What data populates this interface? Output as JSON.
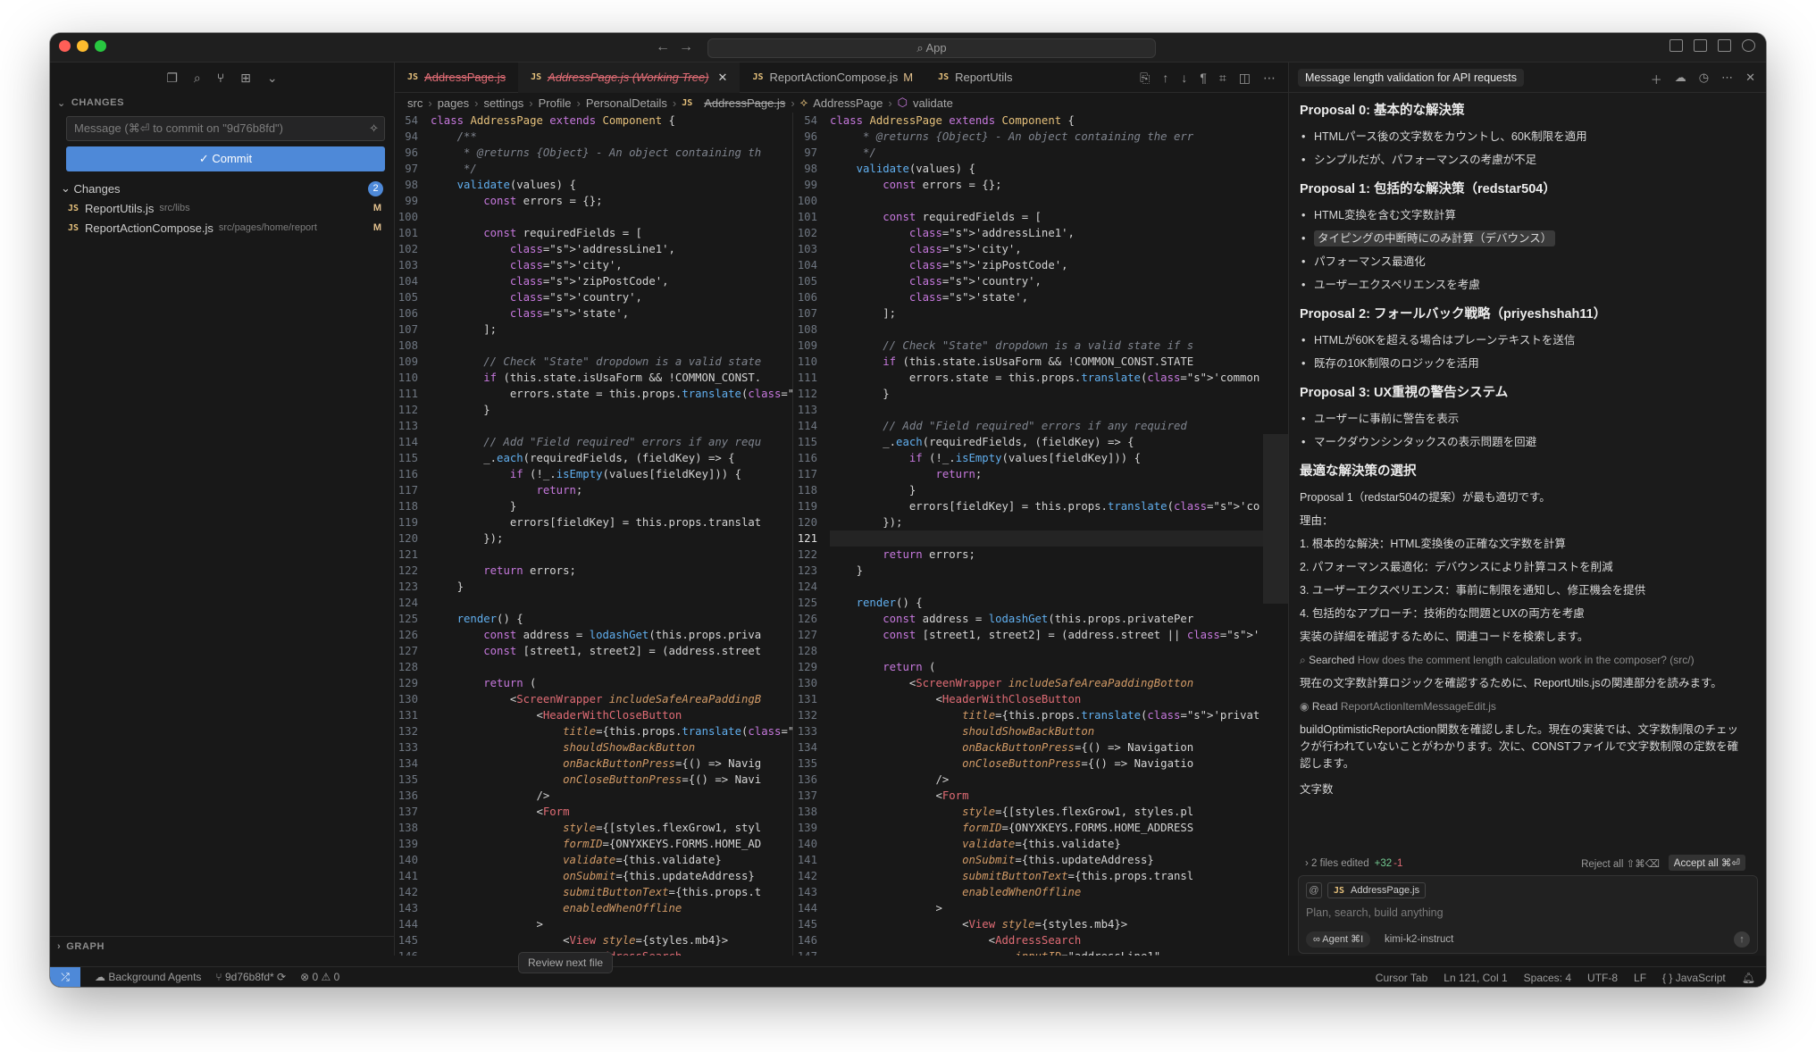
{
  "window": {
    "search_label": "App"
  },
  "sidebar": {
    "changes_header": "CHANGES",
    "commit_placeholder": "Message (⌘⏎ to commit on \"9d76b8fd\")",
    "commit_label": "✓ Commit",
    "changes_label": "Changes",
    "changes_count": "2",
    "files": [
      {
        "name": "ReportUtils.js",
        "path": "src/libs",
        "status": "M"
      },
      {
        "name": "ReportActionCompose.js",
        "path": "src/pages/home/report",
        "status": "M"
      }
    ],
    "graph_header": "GRAPH"
  },
  "tabs": [
    {
      "label": "AddressPage.js",
      "kind": "deleted"
    },
    {
      "label": "AddressPage.js (Working Tree)",
      "kind": "active"
    },
    {
      "label": "ReportActionCompose.js",
      "status": "M"
    },
    {
      "label": "ReportUtils"
    }
  ],
  "breadcrumb": [
    "src",
    "pages",
    "settings",
    "Profile",
    "PersonalDetails",
    "AddressPage.js",
    "AddressPage",
    "validate"
  ],
  "review_next": "Review next file",
  "code_left": [
    [
      "54",
      "class AddressPage extends Component {"
    ],
    [
      "94",
      "    /**"
    ],
    [
      "96",
      "     * @returns {Object} - An object containing th"
    ],
    [
      "97",
      "     */"
    ],
    [
      "98",
      "    validate(values) {"
    ],
    [
      "99",
      "        const errors = {};"
    ],
    [
      "100",
      ""
    ],
    [
      "101",
      "        const requiredFields = ["
    ],
    [
      "102",
      "            'addressLine1',"
    ],
    [
      "103",
      "            'city',"
    ],
    [
      "104",
      "            'zipPostCode',"
    ],
    [
      "105",
      "            'country',"
    ],
    [
      "106",
      "            'state',"
    ],
    [
      "107",
      "        ];"
    ],
    [
      "108",
      ""
    ],
    [
      "109",
      "        // Check \"State\" dropdown is a valid state"
    ],
    [
      "110",
      "        if (this.state.isUsaForm && !COMMON_CONST."
    ],
    [
      "111",
      "            errors.state = this.props.translate('c"
    ],
    [
      "112",
      "        }"
    ],
    [
      "113",
      ""
    ],
    [
      "114",
      "        // Add \"Field required\" errors if any requ"
    ],
    [
      "115",
      "        _.each(requiredFields, (fieldKey) => {"
    ],
    [
      "116",
      "            if (!_.isEmpty(values[fieldKey])) {"
    ],
    [
      "117",
      "                return;"
    ],
    [
      "118",
      "            }"
    ],
    [
      "119",
      "            errors[fieldKey] = this.props.translat"
    ],
    [
      "120",
      "        });"
    ],
    [
      "121",
      ""
    ],
    [
      "122",
      "        return errors;"
    ],
    [
      "123",
      "    }"
    ],
    [
      "124",
      ""
    ],
    [
      "125",
      "    render() {"
    ],
    [
      "126",
      "        const address = lodashGet(this.props.priva"
    ],
    [
      "127",
      "        const [street1, street2] = (address.street"
    ],
    [
      "128",
      ""
    ],
    [
      "129",
      "        return ("
    ],
    [
      "130",
      "            <ScreenWrapper includeSafeAreaPaddingB"
    ],
    [
      "131",
      "                <HeaderWithCloseButton"
    ],
    [
      "132",
      "                    title={this.props.translate('p"
    ],
    [
      "133",
      "                    shouldShowBackButton"
    ],
    [
      "134",
      "                    onBackButtonPress={() => Navig"
    ],
    [
      "135",
      "                    onCloseButtonPress={() => Navi"
    ],
    [
      "136",
      "                />"
    ],
    [
      "137",
      "                <Form"
    ],
    [
      "138",
      "                    style={[styles.flexGrow1, styl"
    ],
    [
      "139",
      "                    formID={ONYXKEYS.FORMS.HOME_AD"
    ],
    [
      "140",
      "                    validate={this.validate}"
    ],
    [
      "141",
      "                    onSubmit={this.updateAddress}"
    ],
    [
      "142",
      "                    submitButtonText={this.props.t"
    ],
    [
      "143",
      "                    enabledWhenOffline"
    ],
    [
      "144",
      "                >"
    ],
    [
      "145",
      "                    <View style={styles.mb4}>"
    ],
    [
      "146",
      "                        <AddressSearch"
    ]
  ],
  "code_right": [
    [
      "54",
      "class AddressPage extends Component {"
    ],
    [
      "96",
      "     * @returns {Object} - An object containing the err"
    ],
    [
      "97",
      "     */"
    ],
    [
      "98",
      "    validate(values) {"
    ],
    [
      "99",
      "        const errors = {};"
    ],
    [
      "100",
      ""
    ],
    [
      "101",
      "        const requiredFields = ["
    ],
    [
      "102",
      "            'addressLine1',"
    ],
    [
      "103",
      "            'city',"
    ],
    [
      "104",
      "            'zipPostCode',"
    ],
    [
      "105",
      "            'country',"
    ],
    [
      "106",
      "            'state',"
    ],
    [
      "107",
      "        ];"
    ],
    [
      "108",
      ""
    ],
    [
      "109",
      "        // Check \"State\" dropdown is a valid state if s"
    ],
    [
      "110",
      "        if (this.state.isUsaForm && !COMMON_CONST.STATE"
    ],
    [
      "111",
      "            errors.state = this.props.translate('common"
    ],
    [
      "112",
      "        }"
    ],
    [
      "113",
      ""
    ],
    [
      "114",
      "        // Add \"Field required\" errors if any required"
    ],
    [
      "115",
      "        _.each(requiredFields, (fieldKey) => {"
    ],
    [
      "116",
      "            if (!_.isEmpty(values[fieldKey])) {"
    ],
    [
      "117",
      "                return;"
    ],
    [
      "118",
      "            }"
    ],
    [
      "119",
      "            errors[fieldKey] = this.props.translate('co"
    ],
    [
      "120",
      "        });"
    ],
    [
      "121",
      ""
    ],
    [
      "122",
      "        return errors;"
    ],
    [
      "123",
      "    }"
    ],
    [
      "124",
      ""
    ],
    [
      "125",
      "    render() {"
    ],
    [
      "126",
      "        const address = lodashGet(this.props.privatePer"
    ],
    [
      "127",
      "        const [street1, street2] = (address.street || '"
    ],
    [
      "128",
      ""
    ],
    [
      "129",
      "        return ("
    ],
    [
      "130",
      "            <ScreenWrapper includeSafeAreaPaddingBotton"
    ],
    [
      "131",
      "                <HeaderWithCloseButton"
    ],
    [
      "132",
      "                    title={this.props.translate('privat"
    ],
    [
      "133",
      "                    shouldShowBackButton"
    ],
    [
      "134",
      "                    onBackButtonPress={() => Navigation"
    ],
    [
      "135",
      "                    onCloseButtonPress={() => Navigatio"
    ],
    [
      "136",
      "                />"
    ],
    [
      "137",
      "                <Form"
    ],
    [
      "138",
      "                    style={[styles.flexGrow1, styles.pl"
    ],
    [
      "139",
      "                    formID={ONYXKEYS.FORMS.HOME_ADDRESS"
    ],
    [
      "140",
      "                    validate={this.validate}"
    ],
    [
      "141",
      "                    onSubmit={this.updateAddress}"
    ],
    [
      "142",
      "                    submitButtonText={this.props.transl"
    ],
    [
      "143",
      "                    enabledWhenOffline"
    ],
    [
      "144",
      "                >"
    ],
    [
      "145",
      "                    <View style={styles.mb4}>"
    ],
    [
      "146",
      "                        <AddressSearch"
    ],
    [
      "147",
      "                            inputID=\"addressLine1\""
    ]
  ],
  "current_line": "121",
  "chat": {
    "title": "Message length validation for API requests",
    "p0_title": "Proposal 0: 基本的な解決策",
    "p0_items": [
      "HTMLパース後の文字数をカウントし、60K制限を適用",
      "シンプルだが、パフォーマンスの考慮が不足"
    ],
    "p1_title": "Proposal 1: 包括的な解決策（redstar504）",
    "p1_items": [
      "HTML変換を含む文字数計算",
      "タイピングの中断時にのみ計算（デバウンス）",
      "パフォーマンス最適化",
      "ユーザーエクスペリエンスを考慮"
    ],
    "p2_title": "Proposal 2: フォールバック戦略（priyeshshah11）",
    "p2_items": [
      "HTMLが60Kを超える場合はプレーンテキストを送信",
      "既存の10K制限のロジックを活用"
    ],
    "p3_title": "Proposal 3: UX重視の警告システム",
    "p3_items": [
      "ユーザーに事前に警告を表示",
      "マークダウンシンタックスの表示問題を回避"
    ],
    "best_title": "最適な解決策の選択",
    "best_intro": "Proposal 1（redstar504の提案）が最も適切です。",
    "reason_label": "理由：",
    "reasons": [
      "1. 根本的な解決：HTML変換後の正確な文字数を計算",
      "2. パフォーマンス最適化：デバウンスにより計算コストを削減",
      "3. ユーザーエクスペリエンス：事前に制限を通知し、修正機会を提供",
      "4. 包括的なアプローチ：技術的な問題とUXの両方を考慮"
    ],
    "search_intro": "実装の詳細を確認するために、関連コードを検索します。",
    "searched_label": "Searched",
    "searched_query": "How does the comment length calculation work in the composer? (src/)",
    "read_intro": "現在の文字数計算ロジックを確認するために、ReportUtils.jsの関連部分を読みます。",
    "read_label": "Read",
    "read_file": "ReportActionItemMessageEdit.js",
    "build_para": "buildOptimisticReportAction関数を確認しました。現在の実装では、文字数制限のチェックが行われていないことがわかります。次に、CONSTファイルで文字数制限の定数を確認します。",
    "char_count": "文字数",
    "files_edited": "2 files edited",
    "added": "+32",
    "removed": "-1",
    "reject_all": "Reject all ⇧⌘⌫",
    "accept_all": "Accept all ⌘⏎",
    "context_file": "AddressPage.js",
    "input_placeholder": "Plan, search, build anything",
    "agent_label": "∞ Agent ⌘I",
    "model": "kimi-k2-instruct"
  },
  "status": {
    "background_agents": "Background Agents",
    "branch": "9d76b8fd*",
    "problems": "⊗ 0 ⚠ 0",
    "cursor_tab": "Cursor Tab",
    "position": "Ln 121, Col 1",
    "spaces": "Spaces: 4",
    "encoding": "UTF-8",
    "eol": "LF",
    "language": "{ } JavaScript"
  },
  "colors": {
    "accent": "#4e89d8",
    "background": "#181818",
    "deleted": "#e06c75",
    "modified": "#e2c08d"
  },
  "icons": [
    "copy-icon",
    "search-icon",
    "source-control-icon",
    "extensions-icon",
    "sparkle-icon",
    "close-icon",
    "gear-icon",
    "bell-icon"
  ]
}
